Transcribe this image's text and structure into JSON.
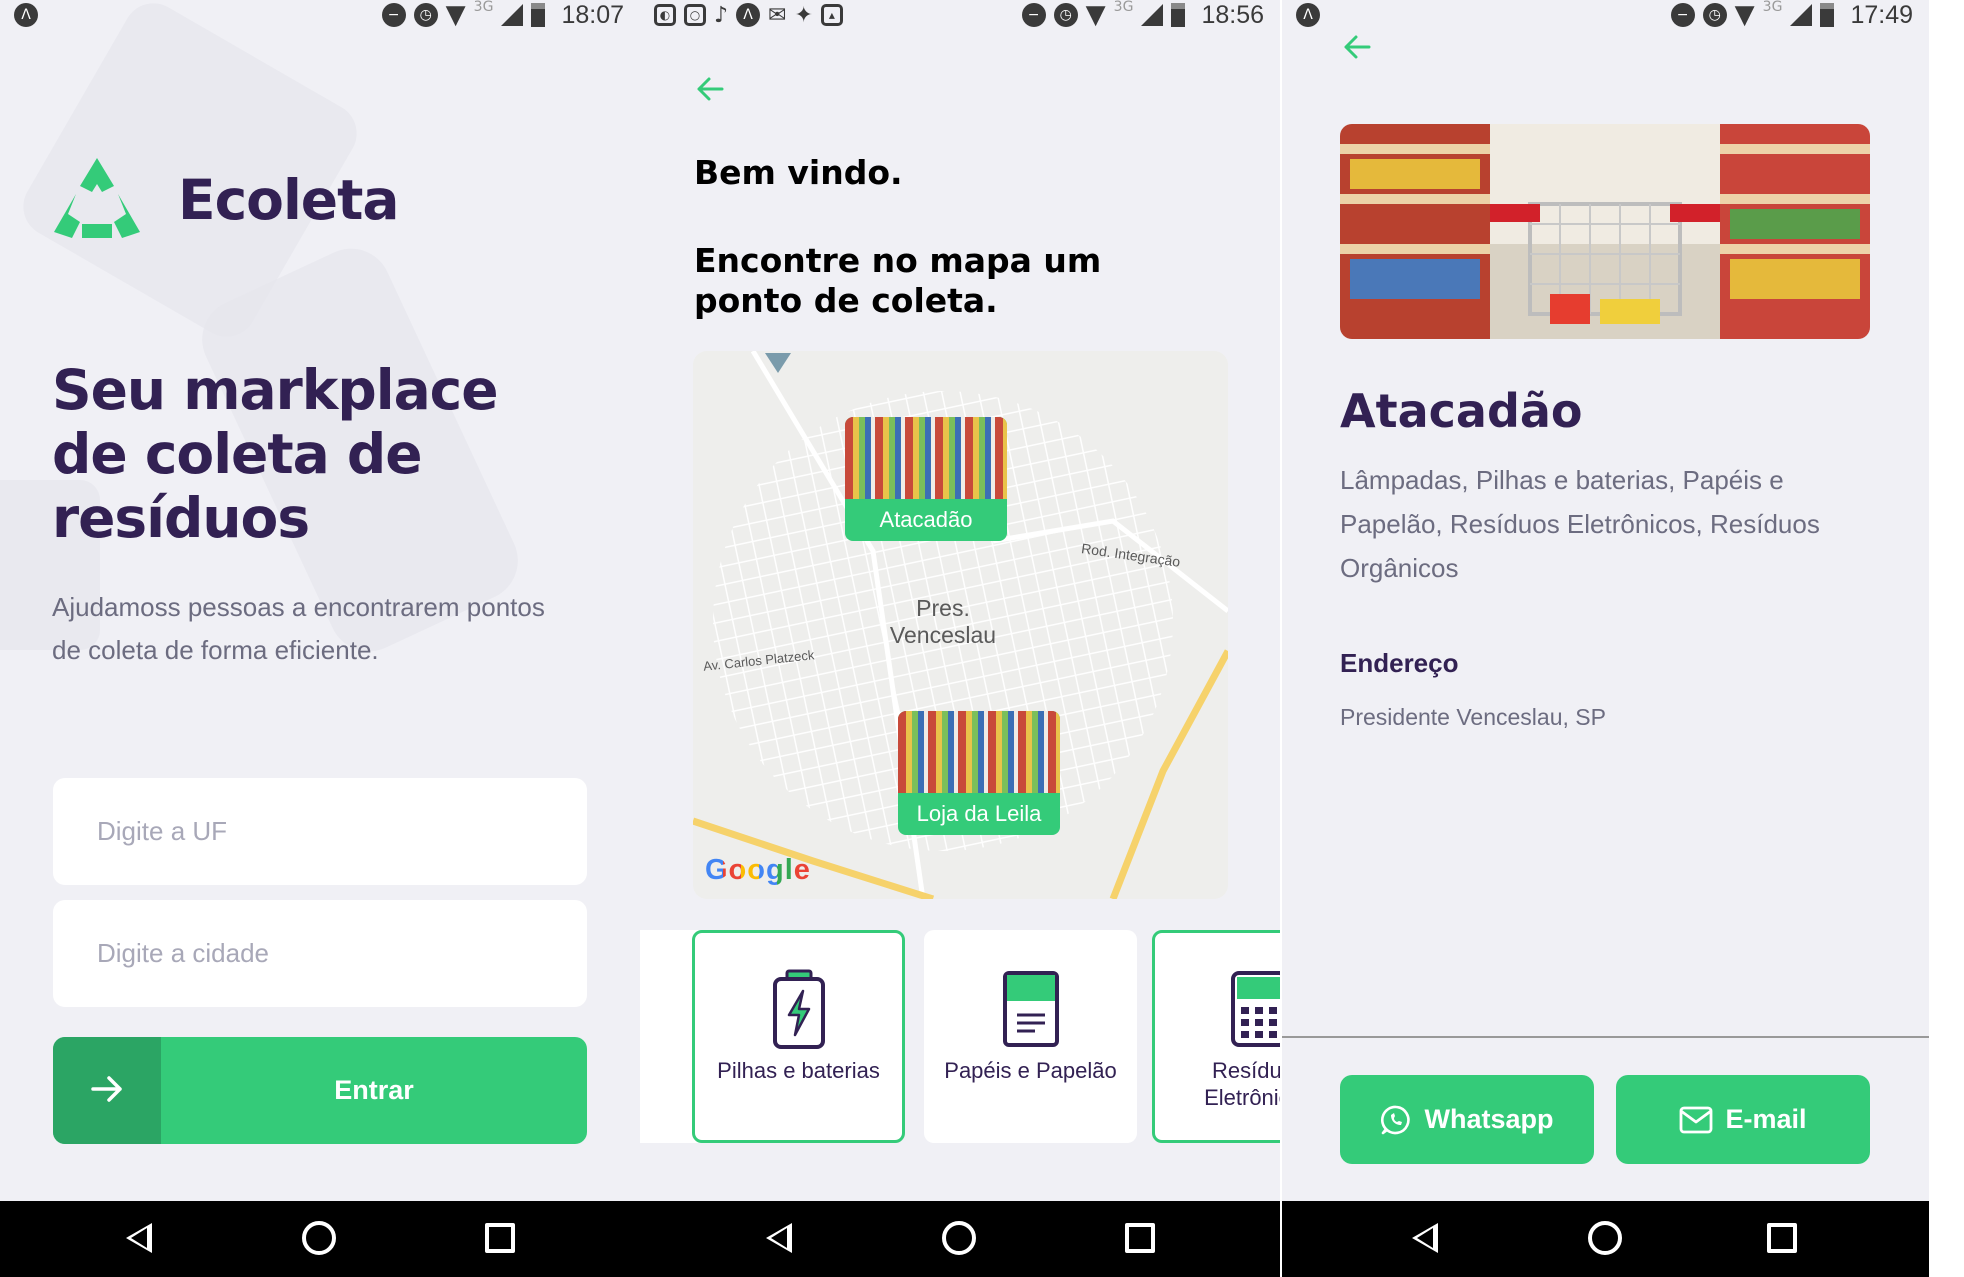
{
  "colors": {
    "primary": "#34cb79",
    "primary_dark": "#2ba564",
    "title": "#322153",
    "text": "#6c6c80",
    "background": "#f0f0f5"
  },
  "screen1": {
    "status": {
      "time": "18:07",
      "network": "3G"
    },
    "app_name": "Ecoleta",
    "hero_title": "Seu markplace de coleta de resíduos",
    "hero_description": "Ajudamoss pessoas a encontrarem pontos de coleta de forma eficiente.",
    "uf_placeholder": "Digite a UF",
    "city_placeholder": "Digite a cidade",
    "enter_label": "Entrar"
  },
  "screen2": {
    "status": {
      "time": "18:56",
      "network": "3G"
    },
    "welcome": "Bem vindo.",
    "instruction": "Encontre no mapa um ponto de coleta.",
    "map": {
      "city_label": "Pres. Venceslau",
      "road_label_1": "Rod. Integração",
      "road_label_2": "Av. Carlos Platzeck",
      "attribution": "Google",
      "markers": [
        {
          "name": "Atacadão"
        },
        {
          "name": "Loja da Leila"
        }
      ]
    },
    "items": [
      {
        "label": "Pilhas e baterias",
        "icon": "battery-icon",
        "selected": true
      },
      {
        "label": "Papéis e Papelão",
        "icon": "paper-icon",
        "selected": false
      },
      {
        "label": "Resíduos Eletrônicos",
        "icon": "electronics-icon",
        "selected": true
      }
    ]
  },
  "screen3": {
    "status": {
      "time": "17:49",
      "network": "3G"
    },
    "point_name": "Atacadão",
    "point_items": " Lâmpadas, Pilhas e baterias, Papéis e Papelão, Resíduos Eletrônicos, Resíduos Orgânicos",
    "address_title": "Endereço",
    "address_value": "Presidente Venceslau, SP",
    "whatsapp_label": "Whatsapp",
    "email_label": "E-mail"
  }
}
